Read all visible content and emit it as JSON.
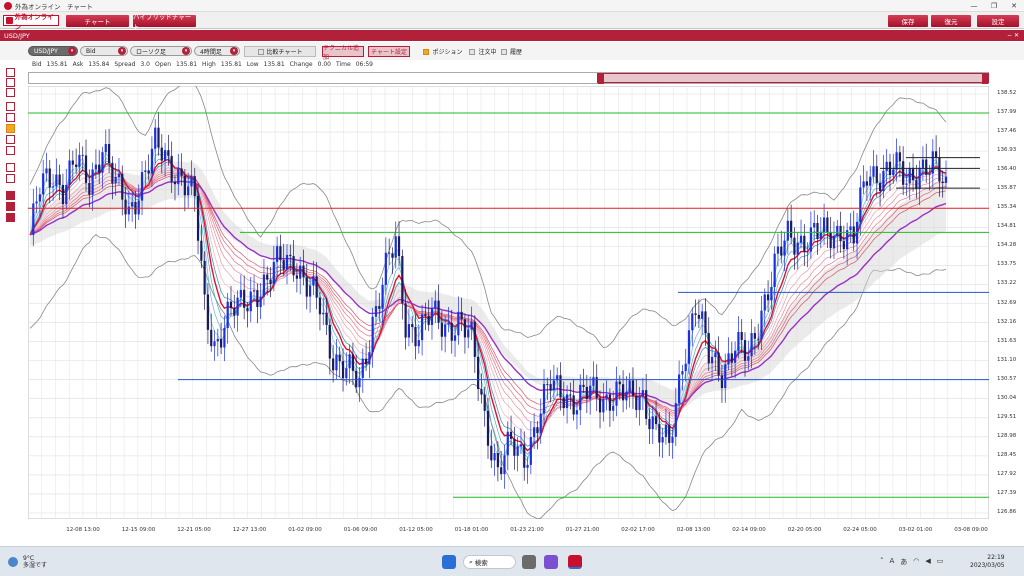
{
  "window": {
    "title": "外為オンライン　チャート",
    "controls": [
      "—",
      "❐",
      "✕"
    ]
  },
  "menubar": {
    "brand": "外為オンライン",
    "chart_label": "チャート",
    "hybrid_label": "ハイブリッドチャート",
    "save_label": "保存",
    "restore_label": "復元",
    "settings_label": "設定"
  },
  "symbol_bar": {
    "pair": "USD/JPY",
    "controls": "− ✕"
  },
  "toolbar": {
    "pair_select": "USD/JPY",
    "price_select": "Bid",
    "chart_type_select": "ローソク足",
    "period_select": "4時間足",
    "compare_label": "比較チャート",
    "add_technical_label": "テクニカル追加",
    "chart_settings_label": "チャート設定",
    "position_label": "ポジション",
    "orders_label": "注文中",
    "history_label": "履歴"
  },
  "info": {
    "bid_label": "Bid",
    "bid": "135.81",
    "ask_label": "Ask",
    "ask": "135.84",
    "spread_label": "Spread",
    "spread": "3.0",
    "open_label": "Open",
    "open": "135.81",
    "high_label": "High",
    "high": "135.81",
    "low_label": "Low",
    "low": "135.81",
    "change_label": "Change",
    "change": "0.00",
    "time_label": "Time",
    "time": "06:59"
  },
  "chart_data": {
    "type": "line",
    "x_labels": [
      "12-08 13:00",
      "12-15 09:00",
      "12-21 05:00",
      "12-27 13:00",
      "01-02 09:00",
      "01-06 09:00",
      "01-12 05:00",
      "01-18 01:00",
      "01-23 21:00",
      "01-27 21:00",
      "02-02 17:00",
      "02-08 13:00",
      "02-14 09:00",
      "02-20 05:00",
      "02-24 05:00",
      "03-02 01:00",
      "03-08 09:00"
    ],
    "y_ticks": [
      "138.52",
      "137.99",
      "137.46",
      "136.93",
      "136.40",
      "135.87",
      "135.34",
      "134.81",
      "134.28",
      "133.75",
      "133.22",
      "132.69",
      "132.16",
      "131.63",
      "131.10",
      "130.57",
      "130.04",
      "129.51",
      "128.98",
      "128.45",
      "127.92",
      "127.39",
      "126.86"
    ],
    "ylim": [
      126.86,
      138.52
    ],
    "price_series": [
      {
        "x": 0,
        "y": 134.6
      },
      {
        "x": 3,
        "y": 135.8
      },
      {
        "x": 7,
        "y": 136.3
      },
      {
        "x": 10,
        "y": 136.0
      },
      {
        "x": 14,
        "y": 136.6
      },
      {
        "x": 18,
        "y": 136.0
      },
      {
        "x": 22,
        "y": 137.2
      },
      {
        "x": 26,
        "y": 135.9
      },
      {
        "x": 30,
        "y": 135.2
      },
      {
        "x": 34,
        "y": 136.2
      },
      {
        "x": 38,
        "y": 137.0
      },
      {
        "x": 42,
        "y": 136.6
      },
      {
        "x": 46,
        "y": 136.3
      },
      {
        "x": 50,
        "y": 135.5
      },
      {
        "x": 53,
        "y": 132.6
      },
      {
        "x": 56,
        "y": 131.6
      },
      {
        "x": 60,
        "y": 132.3
      },
      {
        "x": 64,
        "y": 132.6
      },
      {
        "x": 68,
        "y": 133.1
      },
      {
        "x": 72,
        "y": 133.2
      },
      {
        "x": 76,
        "y": 133.9
      },
      {
        "x": 80,
        "y": 134.0
      },
      {
        "x": 84,
        "y": 133.1
      },
      {
        "x": 88,
        "y": 132.6
      },
      {
        "x": 92,
        "y": 131.3
      },
      {
        "x": 96,
        "y": 130.8
      },
      {
        "x": 100,
        "y": 130.4
      },
      {
        "x": 104,
        "y": 132.3
      },
      {
        "x": 108,
        "y": 133.6
      },
      {
        "x": 111,
        "y": 134.3
      },
      {
        "x": 114,
        "y": 132.2
      },
      {
        "x": 118,
        "y": 131.9
      },
      {
        "x": 122,
        "y": 132.3
      },
      {
        "x": 126,
        "y": 132.1
      },
      {
        "x": 130,
        "y": 132.2
      },
      {
        "x": 134,
        "y": 131.6
      },
      {
        "x": 138,
        "y": 129.6
      },
      {
        "x": 142,
        "y": 128.0
      },
      {
        "x": 146,
        "y": 128.7
      },
      {
        "x": 150,
        "y": 128.5
      },
      {
        "x": 154,
        "y": 129.4
      },
      {
        "x": 158,
        "y": 130.4
      },
      {
        "x": 162,
        "y": 130.3
      },
      {
        "x": 166,
        "y": 129.9
      },
      {
        "x": 170,
        "y": 130.2
      },
      {
        "x": 174,
        "y": 130.1
      },
      {
        "x": 178,
        "y": 130.2
      },
      {
        "x": 182,
        "y": 130.0
      },
      {
        "x": 186,
        "y": 130.2
      },
      {
        "x": 190,
        "y": 129.1
      },
      {
        "x": 194,
        "y": 128.6
      },
      {
        "x": 198,
        "y": 131.2
      },
      {
        "x": 202,
        "y": 132.6
      },
      {
        "x": 206,
        "y": 131.2
      },
      {
        "x": 210,
        "y": 130.9
      },
      {
        "x": 214,
        "y": 131.5
      },
      {
        "x": 218,
        "y": 131.1
      },
      {
        "x": 222,
        "y": 132.6
      },
      {
        "x": 226,
        "y": 133.7
      },
      {
        "x": 230,
        "y": 134.5
      },
      {
        "x": 234,
        "y": 134.5
      },
      {
        "x": 238,
        "y": 134.6
      },
      {
        "x": 242,
        "y": 134.5
      },
      {
        "x": 246,
        "y": 134.8
      },
      {
        "x": 250,
        "y": 134.5
      },
      {
        "x": 254,
        "y": 136.2
      },
      {
        "x": 258,
        "y": 136.4
      },
      {
        "x": 262,
        "y": 136.5
      },
      {
        "x": 266,
        "y": 136.0
      },
      {
        "x": 270,
        "y": 136.6
      },
      {
        "x": 274,
        "y": 136.5
      },
      {
        "x": 278,
        "y": 135.8
      }
    ],
    "horizontal_lines": [
      {
        "price": 137.99,
        "color": "#22bb22"
      },
      {
        "price": 135.34,
        "color": "#e02020"
      },
      {
        "price": 134.67,
        "color": "#22bb22"
      },
      {
        "price": 133.0,
        "color": "#2255cc"
      },
      {
        "price": 130.57,
        "color": "#2255cc"
      },
      {
        "price": 127.3,
        "color": "#22bb22"
      },
      {
        "price": 136.75,
        "color": "#222222"
      },
      {
        "price": 136.45,
        "color": "#222222"
      },
      {
        "price": 135.9,
        "color": "#222222"
      }
    ],
    "grid": true
  },
  "taskbar": {
    "weather_temp": "9°C",
    "weather_desc": "多湿です",
    "search_label": "検索",
    "time": "22:19",
    "date": "2023/03/05"
  }
}
